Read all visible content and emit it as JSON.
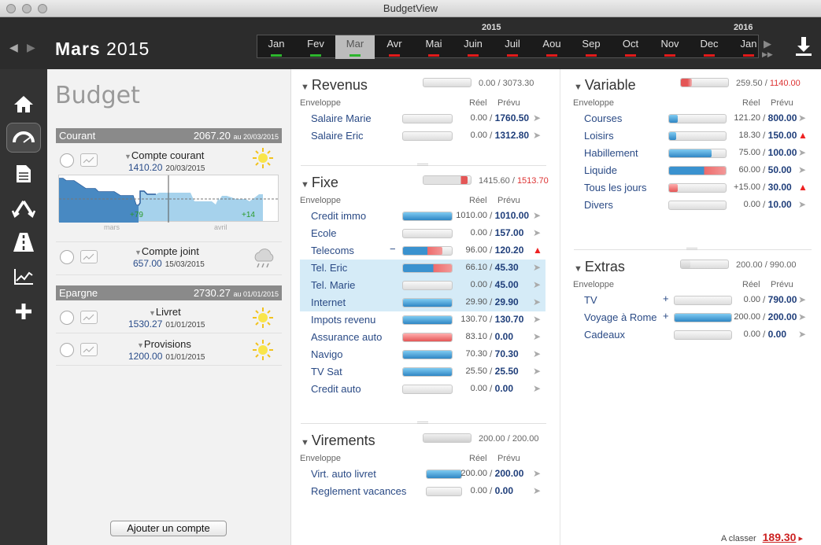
{
  "window": {
    "title": "BudgetView"
  },
  "header": {
    "month": "Mars",
    "year": "2015",
    "timeline": {
      "year_left": "2015",
      "year_right": "2016",
      "months": [
        {
          "label": "Jan",
          "status": "green"
        },
        {
          "label": "Fev",
          "status": "green"
        },
        {
          "label": "Mar",
          "status": "green",
          "selected": true
        },
        {
          "label": "Avr",
          "status": "red"
        },
        {
          "label": "Mai",
          "status": "red"
        },
        {
          "label": "Juin",
          "status": "red"
        },
        {
          "label": "Juil",
          "status": "red"
        },
        {
          "label": "Aou",
          "status": "red"
        },
        {
          "label": "Sep",
          "status": "red"
        },
        {
          "label": "Oct",
          "status": "red"
        },
        {
          "label": "Nov",
          "status": "red"
        },
        {
          "label": "Dec",
          "status": "red"
        },
        {
          "label": "Jan",
          "status": "red"
        }
      ]
    }
  },
  "sidebar": {
    "items": [
      "home-icon",
      "budget-gauge-icon",
      "document-icon",
      "transfer-icon",
      "road-icon",
      "chart-icon",
      "plus-icon"
    ]
  },
  "accounts": {
    "title": "Budget",
    "courant": {
      "label": "Courant",
      "amount": "2067.20",
      "date": "au 20/03/2015"
    },
    "compte_courant": {
      "name": "Compte courant",
      "balance": "1410.20",
      "date": "20/03/2015",
      "chart": {
        "plus1": "+79",
        "plus2": "+14",
        "month1": "mars",
        "month2": "avril"
      }
    },
    "compte_joint": {
      "name": "Compte joint",
      "balance": "657.00",
      "date": "15/03/2015"
    },
    "epargne": {
      "label": "Epargne",
      "amount": "2730.27",
      "date": "au 01/01/2015"
    },
    "livret": {
      "name": "Livret",
      "balance": "1530.27",
      "date": "01/01/2015"
    },
    "provisions": {
      "name": "Provisions",
      "balance": "1200.00",
      "date": "01/01/2015"
    },
    "add_button": "Ajouter un compte"
  },
  "colors": {
    "blue": "#2f86c4",
    "red": "#e45656",
    "dark": "#2c2c2c"
  },
  "labels": {
    "enveloppe": "Enveloppe",
    "reel": "Réel",
    "prevu": "Prévu"
  },
  "revenus": {
    "title": "Revenus",
    "real": "0.00",
    "plan": "3073.30",
    "fill": 0,
    "plan_red": false,
    "rows": [
      {
        "name": "Salaire Marie",
        "real": "0.00",
        "plan": "1760.50",
        "fill": 0,
        "color": "grey"
      },
      {
        "name": "Salaire Eric",
        "real": "0.00",
        "plan": "1312.80",
        "fill": 0,
        "color": "grey"
      }
    ]
  },
  "fixe": {
    "title": "Fixe",
    "real": "1415.60",
    "plan": "1513.70",
    "fill": 0.94,
    "plan_red": true,
    "rows": [
      {
        "name": "Credit immo",
        "real": "1010.00",
        "plan": "1010.00",
        "fill": 1,
        "color": "blue"
      },
      {
        "name": "Ecole",
        "real": "0.00",
        "plan": "157.00",
        "fill": 0,
        "color": "grey"
      },
      {
        "name": "Telecoms",
        "real": "96.00",
        "plan": "120.20",
        "fill": 0.8,
        "color": "mixed",
        "minus": "−",
        "alert": true
      },
      {
        "name": "Tel. Eric",
        "real": "66.10",
        "plan": "45.30",
        "fill": 1,
        "color": "mixed",
        "hl": true
      },
      {
        "name": "Tel. Marie",
        "real": "0.00",
        "plan": "45.00",
        "fill": 0,
        "color": "grey",
        "hl": true
      },
      {
        "name": "Internet",
        "real": "29.90",
        "plan": "29.90",
        "fill": 1,
        "color": "blue",
        "hl": true
      },
      {
        "name": "Impots revenu",
        "real": "130.70",
        "plan": "130.70",
        "fill": 1,
        "color": "blue"
      },
      {
        "name": "Assurance auto",
        "real": "83.10",
        "plan": "0.00",
        "fill": 1,
        "color": "red"
      },
      {
        "name": "Navigo",
        "real": "70.30",
        "plan": "70.30",
        "fill": 1,
        "color": "blue"
      },
      {
        "name": "TV Sat",
        "real": "25.50",
        "plan": "25.50",
        "fill": 1,
        "color": "blue"
      },
      {
        "name": "Credit auto",
        "real": "0.00",
        "plan": "0.00",
        "fill": 0,
        "color": "grey"
      }
    ]
  },
  "virements": {
    "title": "Virements",
    "real": "200.00",
    "plan": "200.00",
    "fill": 1,
    "plan_red": false,
    "section_color": "grey",
    "rows": [
      {
        "name": "Virt. auto livret",
        "real": "200.00",
        "plan": "200.00",
        "fill": 1,
        "color": "blue"
      },
      {
        "name": "Reglement vacances",
        "real": "0.00",
        "plan": "0.00",
        "fill": 0,
        "color": "grey"
      }
    ]
  },
  "variable": {
    "title": "Variable",
    "real": "259.50",
    "plan": "1140.00",
    "fill": 0.23,
    "plan_red": true,
    "section_color": "red",
    "rows": [
      {
        "name": "Courses",
        "real": "121.20",
        "plan": "800.00",
        "fill": 0.15,
        "color": "blue"
      },
      {
        "name": "Loisirs",
        "real": "18.30",
        "plan": "150.00",
        "fill": 0.12,
        "color": "blue",
        "alert": true
      },
      {
        "name": "Habillement",
        "real": "75.00",
        "plan": "100.00",
        "fill": 0.75,
        "color": "blue"
      },
      {
        "name": "Liquide",
        "real": "60.00",
        "plan": "50.00",
        "fill": 1,
        "color": "mixed"
      },
      {
        "name": "Tous les jours",
        "real": "+15.00",
        "plan": "30.00",
        "fill": 0.15,
        "color": "red",
        "alert": true
      },
      {
        "name": "Divers",
        "real": "0.00",
        "plan": "10.00",
        "fill": 0,
        "color": "grey"
      }
    ]
  },
  "extras": {
    "title": "Extras",
    "real": "200.00",
    "plan": "990.00",
    "fill": 0.2,
    "plan_red": false,
    "section_color": "grey",
    "rows": [
      {
        "name": "TV",
        "real": "0.00",
        "plan": "790.00",
        "fill": 0,
        "color": "grey",
        "plus": "+"
      },
      {
        "name": "Voyage à Rome",
        "real": "200.00",
        "plan": "200.00",
        "fill": 1,
        "color": "blue",
        "plus": "+"
      },
      {
        "name": "Cadeaux",
        "real": "0.00",
        "plan": "0.00",
        "fill": 0,
        "color": "grey"
      }
    ]
  },
  "footer": {
    "a_classer_label": "A classer",
    "a_classer_value": "189.30"
  }
}
